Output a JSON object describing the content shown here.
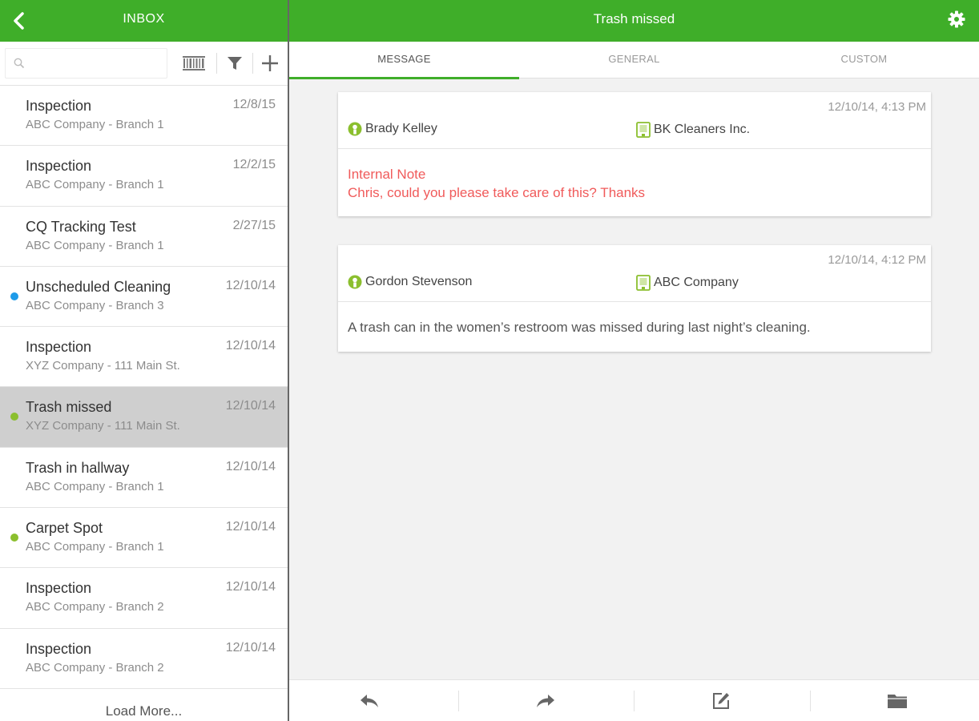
{
  "left_header": {
    "title": "INBOX",
    "back_icon": "back-chevron-icon"
  },
  "right_header": {
    "title": "Trash missed",
    "settings_icon": "gear-icon"
  },
  "search": {
    "placeholder": "",
    "value": ""
  },
  "toolbar": {
    "icons": [
      "search-icon",
      "barcode-icon",
      "filter-icon",
      "add-icon"
    ]
  },
  "inbox": {
    "items": [
      {
        "title": "Inspection",
        "subtitle": "ABC Company - Branch 1",
        "date": "12/8/15",
        "dot": ""
      },
      {
        "title": "Inspection",
        "subtitle": "ABC Company - Branch 1",
        "date": "12/2/15",
        "dot": ""
      },
      {
        "title": "CQ Tracking Test",
        "subtitle": "ABC Company - Branch 1",
        "date": "2/27/15",
        "dot": ""
      },
      {
        "title": "Unscheduled Cleaning",
        "subtitle": "ABC Company - Branch 3",
        "date": "12/10/14",
        "dot": "#1e9be9"
      },
      {
        "title": "Inspection",
        "subtitle": "XYZ Company - 111 Main St.",
        "date": "12/10/14",
        "dot": ""
      },
      {
        "title": "Trash missed",
        "subtitle": "XYZ Company - 111 Main St.",
        "date": "12/10/14",
        "dot": "#8bbf2e",
        "selected": true
      },
      {
        "title": "Trash in hallway",
        "subtitle": "ABC Company - Branch 1",
        "date": "12/10/14",
        "dot": ""
      },
      {
        "title": "Carpet Spot",
        "subtitle": "ABC Company - Branch 1",
        "date": "12/10/14",
        "dot": "#8bbf2e"
      },
      {
        "title": "Inspection",
        "subtitle": "ABC Company - Branch 2",
        "date": "12/10/14",
        "dot": ""
      },
      {
        "title": "Inspection",
        "subtitle": "ABC Company - Branch 2",
        "date": "12/10/14",
        "dot": ""
      }
    ],
    "load_more": "Load More..."
  },
  "tabs": [
    {
      "label": "MESSAGE",
      "active": true
    },
    {
      "label": "GENERAL",
      "active": false
    },
    {
      "label": "CUSTOM",
      "active": false
    }
  ],
  "messages": [
    {
      "time": "12/10/14, 4:13 PM",
      "from": "Brady Kelley",
      "org": "BK Cleaners Inc.",
      "note_title": "Internal Note",
      "note_body": "Chris, could you please take care of this? Thanks"
    },
    {
      "time": "12/10/14, 4:12 PM",
      "from": "Gordon Stevenson",
      "org": "ABC Company",
      "body": "A trash can in the women’s restroom was missed during last night’s cleaning."
    }
  ],
  "bottom_actions": [
    "reply-icon",
    "forward-icon",
    "edit-icon",
    "folder-icon"
  ],
  "colors": {
    "accent": "#3fae29",
    "note": "#f05a5a",
    "selected_row": "#cfcfcf",
    "dot_blue": "#1e9be9",
    "dot_green": "#8bbf2e"
  }
}
